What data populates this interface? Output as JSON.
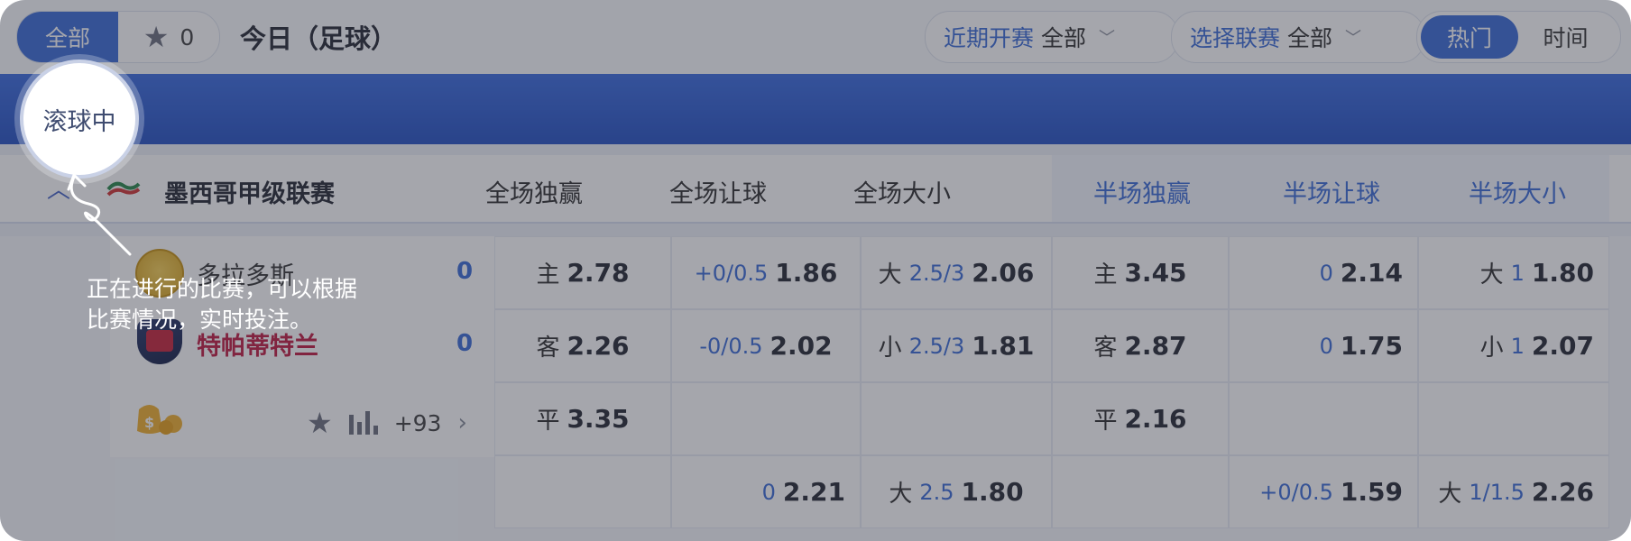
{
  "topbar": {
    "all_label": "全部",
    "fav_count": "0",
    "title": "今日（足球）",
    "recent_label": "近期开赛",
    "recent_value": "全部",
    "league_label": "选择联赛",
    "league_value": "全部",
    "sort_hot": "热门",
    "sort_time": "时间"
  },
  "band": {
    "tail": ""
  },
  "league": {
    "name": "墨西哥甲级联赛",
    "columns": [
      "全场独赢",
      "全场让球",
      "全场大小",
      "半场独赢",
      "半场让球",
      "半场大小"
    ]
  },
  "match": {
    "home": "多拉多斯",
    "away": "特帕蒂特兰",
    "home_score": "0",
    "away_score": "0",
    "more": "+93"
  },
  "rows": [
    {
      "c1": {
        "lbl": "主",
        "odd": "2.78"
      },
      "c2": {
        "hc": "+0/0.5",
        "odd": "1.86"
      },
      "c3": {
        "lbl": "大",
        "hc": "2.5/3",
        "odd": "2.06"
      },
      "c4": {
        "lbl": "主",
        "odd": "3.45"
      },
      "c5": {
        "hc": "0",
        "odd": "2.14"
      },
      "c6": {
        "lbl": "大",
        "hc": "1",
        "odd": "1.80"
      }
    },
    {
      "c1": {
        "lbl": "客",
        "odd": "2.26"
      },
      "c2": {
        "hc": "-0/0.5",
        "odd": "2.02"
      },
      "c3": {
        "lbl": "小",
        "hc": "2.5/3",
        "odd": "1.81"
      },
      "c4": {
        "lbl": "客",
        "odd": "2.87"
      },
      "c5": {
        "hc": "0",
        "odd": "1.75"
      },
      "c6": {
        "lbl": "小",
        "hc": "1",
        "odd": "2.07"
      }
    },
    {
      "c1": {
        "lbl": "平",
        "odd": "3.35"
      },
      "c4": {
        "lbl": "平",
        "odd": "2.16"
      }
    },
    {
      "c2": {
        "hc": "0",
        "odd": "2.21"
      },
      "c3": {
        "lbl": "大",
        "hc": "2.5",
        "odd": "1.80"
      },
      "c5": {
        "hc": "+0/0.5",
        "odd": "1.59"
      },
      "c6": {
        "lbl": "大",
        "hc": "1/1.5",
        "odd": "2.26"
      }
    }
  ],
  "coach": {
    "spot_label": "滚球中",
    "hint_line1": "正在进行的比赛，可以根据",
    "hint_line2": "比赛情况，实时投注。"
  },
  "colors": {
    "brand": "#3f6fd8",
    "away_team": "#c22045"
  }
}
